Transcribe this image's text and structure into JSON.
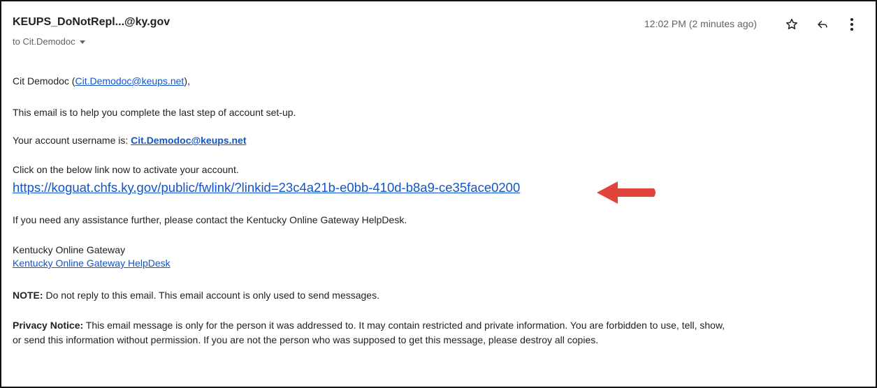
{
  "email": {
    "sender": "KEUPS_DoNotRepl...@ky.gov",
    "to_label": "to Cit.Demodoc",
    "time": "12:02 PM (2 minutes ago)",
    "icons": {
      "star": "star-icon",
      "reply": "reply-icon",
      "more": "more-vert-icon"
    }
  },
  "body": {
    "greeting_name": "Cit Demodoc (",
    "greeting_email": "Cit.Demodoc@keups.net",
    "greeting_end": "),",
    "line_help": "This email is to help you complete the last step of account set-up.",
    "username_label": "Your account username is: ",
    "username_value": "Cit.Demodoc@keups.net",
    "activate_text": "Click on the below link now to activate your account.",
    "activate_link": "https://koguat.chfs.ky.gov/public/fwlink/?linkid=23c4a21b-e0bb-410d-b8a9-ce35face0200",
    "assistance_text": "If you need any assistance further, please contact the Kentucky Online Gateway HelpDesk.",
    "signature_name": "Kentucky Online Gateway",
    "signature_link": "Kentucky Online Gateway HelpDesk",
    "note_label": "NOTE:",
    "note_text": " Do not reply to this email. This email account is only used to send messages.",
    "privacy_label": "Privacy Notice:",
    "privacy_text_1": " This email message is only for the person it was addressed to. It may contain restricted and private information. You are forbidden to use, tell, show,",
    "privacy_text_2": "or send this information without permission. If you are not the person who was supposed to get this message, please destroy all copies."
  },
  "colors": {
    "link": "#1155cc",
    "arrow": "#e0443a",
    "text": "#222222",
    "meta": "#5f6368"
  }
}
